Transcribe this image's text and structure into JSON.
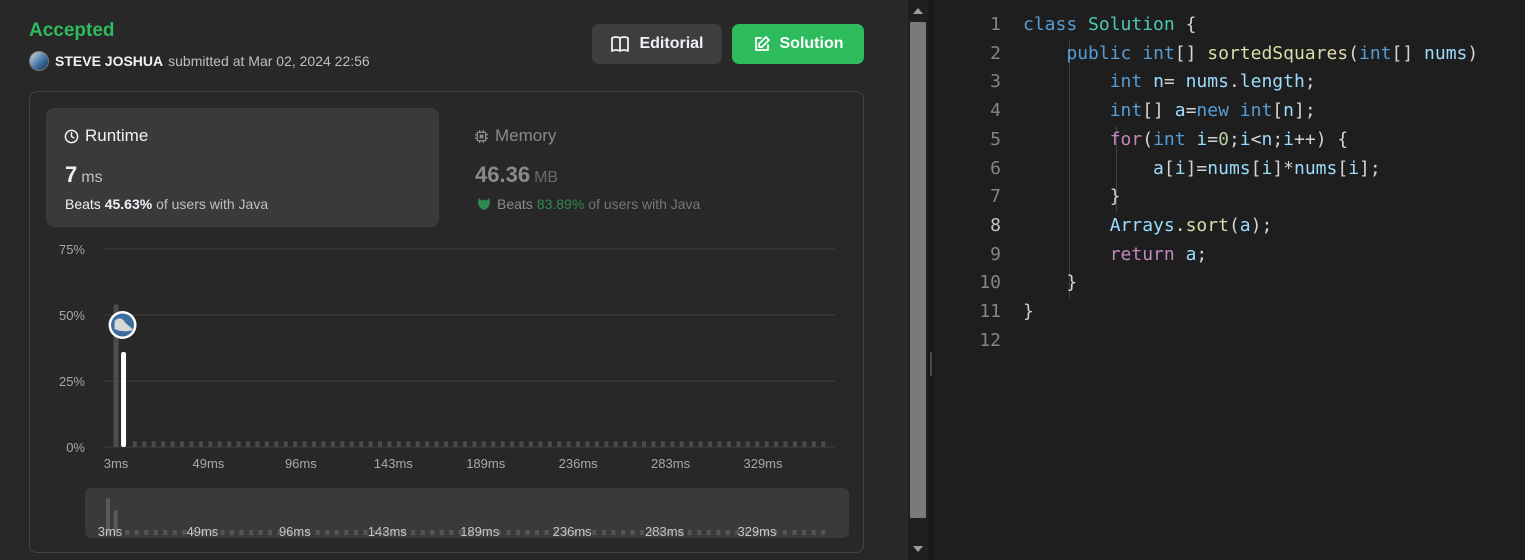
{
  "status": "Accepted",
  "submitter": {
    "name": "STEVE JOSHUA",
    "submitted_text": "submitted at Mar 02, 2024 22:56"
  },
  "buttons": {
    "editorial": "Editorial",
    "solution": "Solution"
  },
  "runtime": {
    "title": "Runtime",
    "value": "7",
    "unit": "ms",
    "beats_prefix": "Beats",
    "beats_pct": "45.63%",
    "beats_suffix": "of users with Java"
  },
  "memory": {
    "title": "Memory",
    "value": "46.36",
    "unit": "MB",
    "beats_prefix": "Beats",
    "beats_pct": "83.89%",
    "beats_suffix": "of users with Java"
  },
  "colors": {
    "accent": "#2cbb5d",
    "background": "#282828",
    "editor_bg": "#1e1e1e"
  },
  "chart_data": {
    "type": "bar",
    "y_tick_labels": [
      "75%",
      "50%",
      "25%",
      "0%"
    ],
    "ylim": [
      0,
      75
    ],
    "x_tick_labels": [
      "3ms",
      "49ms",
      "96ms",
      "143ms",
      "189ms",
      "236ms",
      "283ms",
      "329ms"
    ],
    "xlim": [
      3,
      380
    ],
    "bar_step_ms": 5,
    "bars": [
      {
        "x": 3,
        "value": 54,
        "highlight": false
      },
      {
        "x": 7,
        "value": 36,
        "highlight": true
      }
    ],
    "baseline_value": 1,
    "grid": true,
    "user_marker_at": 7
  },
  "code": {
    "lines": [
      {
        "num": "1",
        "tokens": [
          [
            "k1",
            "class"
          ],
          [
            "p",
            " "
          ],
          [
            "cls",
            "Solution"
          ],
          [
            "p",
            " {"
          ]
        ]
      },
      {
        "num": "2",
        "tokens": [
          [
            "p",
            "    "
          ],
          [
            "k1",
            "public"
          ],
          [
            "p",
            " "
          ],
          [
            "k1",
            "int"
          ],
          [
            "p",
            "[] "
          ],
          [
            "fn",
            "sortedSquares"
          ],
          [
            "p",
            "("
          ],
          [
            "k1",
            "int"
          ],
          [
            "p",
            "[] "
          ],
          [
            "v",
            "nums"
          ],
          [
            "p",
            ")"
          ]
        ]
      },
      {
        "num": "3",
        "tokens": [
          [
            "p",
            "        "
          ],
          [
            "k1",
            "int"
          ],
          [
            "p",
            " "
          ],
          [
            "v",
            "n"
          ],
          [
            "p",
            "= "
          ],
          [
            "v",
            "nums"
          ],
          [
            "p",
            "."
          ],
          [
            "v",
            "length"
          ],
          [
            "p",
            ";"
          ]
        ]
      },
      {
        "num": "4",
        "tokens": [
          [
            "p",
            "        "
          ],
          [
            "k1",
            "int"
          ],
          [
            "p",
            "[] "
          ],
          [
            "v",
            "a"
          ],
          [
            "p",
            "="
          ],
          [
            "k1",
            "new"
          ],
          [
            "p",
            " "
          ],
          [
            "k1",
            "int"
          ],
          [
            "p",
            "["
          ],
          [
            "v",
            "n"
          ],
          [
            "p",
            "];"
          ]
        ]
      },
      {
        "num": "5",
        "tokens": [
          [
            "p",
            "        "
          ],
          [
            "k2",
            "for"
          ],
          [
            "p",
            "("
          ],
          [
            "k1",
            "int"
          ],
          [
            "p",
            " "
          ],
          [
            "v",
            "i"
          ],
          [
            "p",
            "="
          ],
          [
            "n",
            "0"
          ],
          [
            "p",
            ";"
          ],
          [
            "v",
            "i"
          ],
          [
            "p",
            "<"
          ],
          [
            "v",
            "n"
          ],
          [
            "p",
            ";"
          ],
          [
            "v",
            "i"
          ],
          [
            "p",
            "++) {"
          ]
        ]
      },
      {
        "num": "6",
        "tokens": [
          [
            "p",
            "            "
          ],
          [
            "v",
            "a"
          ],
          [
            "p",
            "["
          ],
          [
            "v",
            "i"
          ],
          [
            "p",
            "]="
          ],
          [
            "v",
            "nums"
          ],
          [
            "p",
            "["
          ],
          [
            "v",
            "i"
          ],
          [
            "p",
            "]*"
          ],
          [
            "v",
            "nums"
          ],
          [
            "p",
            "["
          ],
          [
            "v",
            "i"
          ],
          [
            "p",
            "];"
          ]
        ]
      },
      {
        "num": "7",
        "tokens": [
          [
            "p",
            "        }"
          ]
        ]
      },
      {
        "num": "8",
        "tokens": [
          [
            "p",
            "        "
          ],
          [
            "v",
            "Arrays"
          ],
          [
            "p",
            "."
          ],
          [
            "fn",
            "sort"
          ],
          [
            "p",
            "("
          ],
          [
            "v",
            "a"
          ],
          [
            "p",
            ");"
          ]
        ]
      },
      {
        "num": "9",
        "tokens": [
          [
            "p",
            "        "
          ],
          [
            "k2",
            "return"
          ],
          [
            "p",
            " "
          ],
          [
            "v",
            "a"
          ],
          [
            "p",
            ";"
          ]
        ]
      },
      {
        "num": "10",
        "tokens": [
          [
            "p",
            "    }"
          ]
        ]
      },
      {
        "num": "11",
        "tokens": [
          [
            "p",
            "}"
          ]
        ]
      },
      {
        "num": "12",
        "tokens": []
      }
    ],
    "active_line": "8"
  }
}
